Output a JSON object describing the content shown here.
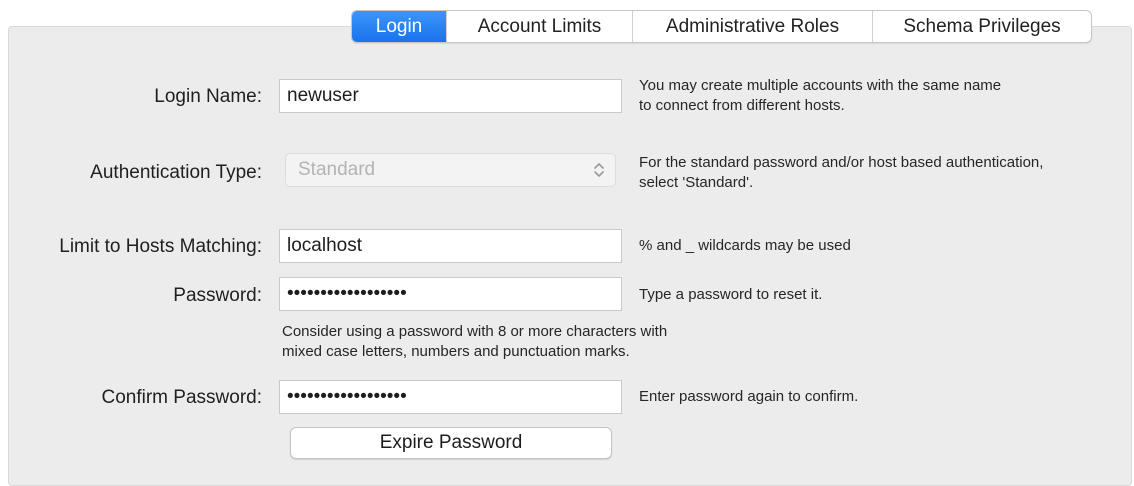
{
  "tabs": [
    {
      "label": "Login",
      "active": true
    },
    {
      "label": "Account Limits",
      "active": false
    },
    {
      "label": "Administrative Roles",
      "active": false
    },
    {
      "label": "Schema Privileges",
      "active": false
    }
  ],
  "form": {
    "login_name": {
      "label": "Login Name:",
      "value": "newuser",
      "help_line1": "You may create multiple accounts with the same name",
      "help_line2": "to connect from different hosts."
    },
    "auth_type": {
      "label": "Authentication Type:",
      "value": "Standard",
      "help_line1": "For the standard password and/or host based authentication,",
      "help_line2": "select 'Standard'."
    },
    "hosts": {
      "label": "Limit to Hosts Matching:",
      "value": "localhost",
      "help": "% and _ wildcards may be used"
    },
    "password": {
      "label": "Password:",
      "value": "••••••••••••••••••",
      "help": "Type a password to reset it."
    },
    "password_hint_line1": "Consider using a password with 8 or more characters with",
    "password_hint_line2": "mixed case letters, numbers and punctuation marks.",
    "confirm_password": {
      "label": "Confirm Password:",
      "value": "••••••••••••••••••",
      "help": "Enter password again to confirm."
    },
    "expire_button": "Expire Password"
  },
  "colors": {
    "accent": "#1a73ec",
    "panel": "#ececec"
  }
}
